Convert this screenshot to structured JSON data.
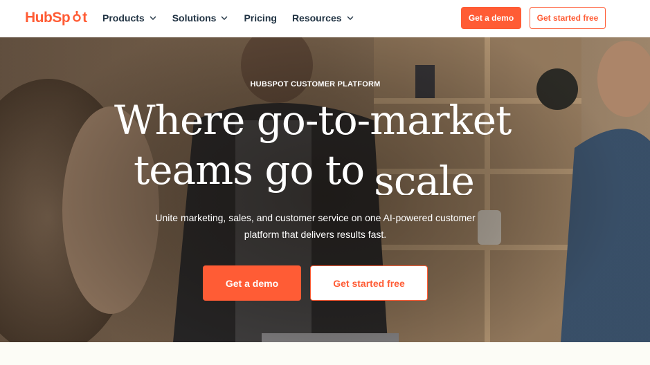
{
  "brand": {
    "name_pre": "Hub",
    "name_post": "t",
    "accent": "#ff5c35",
    "dark": "#213343"
  },
  "nav": {
    "items": [
      {
        "label": "Products",
        "has_dropdown": true
      },
      {
        "label": "Solutions",
        "has_dropdown": true
      },
      {
        "label": "Pricing",
        "has_dropdown": false
      },
      {
        "label": "Resources",
        "has_dropdown": true
      }
    ],
    "demo_label": "Get a demo",
    "free_label": "Get started free"
  },
  "hero": {
    "eyebrow": "HUBSPOT CUSTOMER PLATFORM",
    "headline_line1": "Where go-to-market",
    "headline_line2": "teams go to",
    "headline_rotating": "scale",
    "subtext": "Unite marketing, sales, and customer service on one AI-powered customer platform that delivers results fast.",
    "demo_label": "Get a demo",
    "free_label": "Get started free"
  }
}
